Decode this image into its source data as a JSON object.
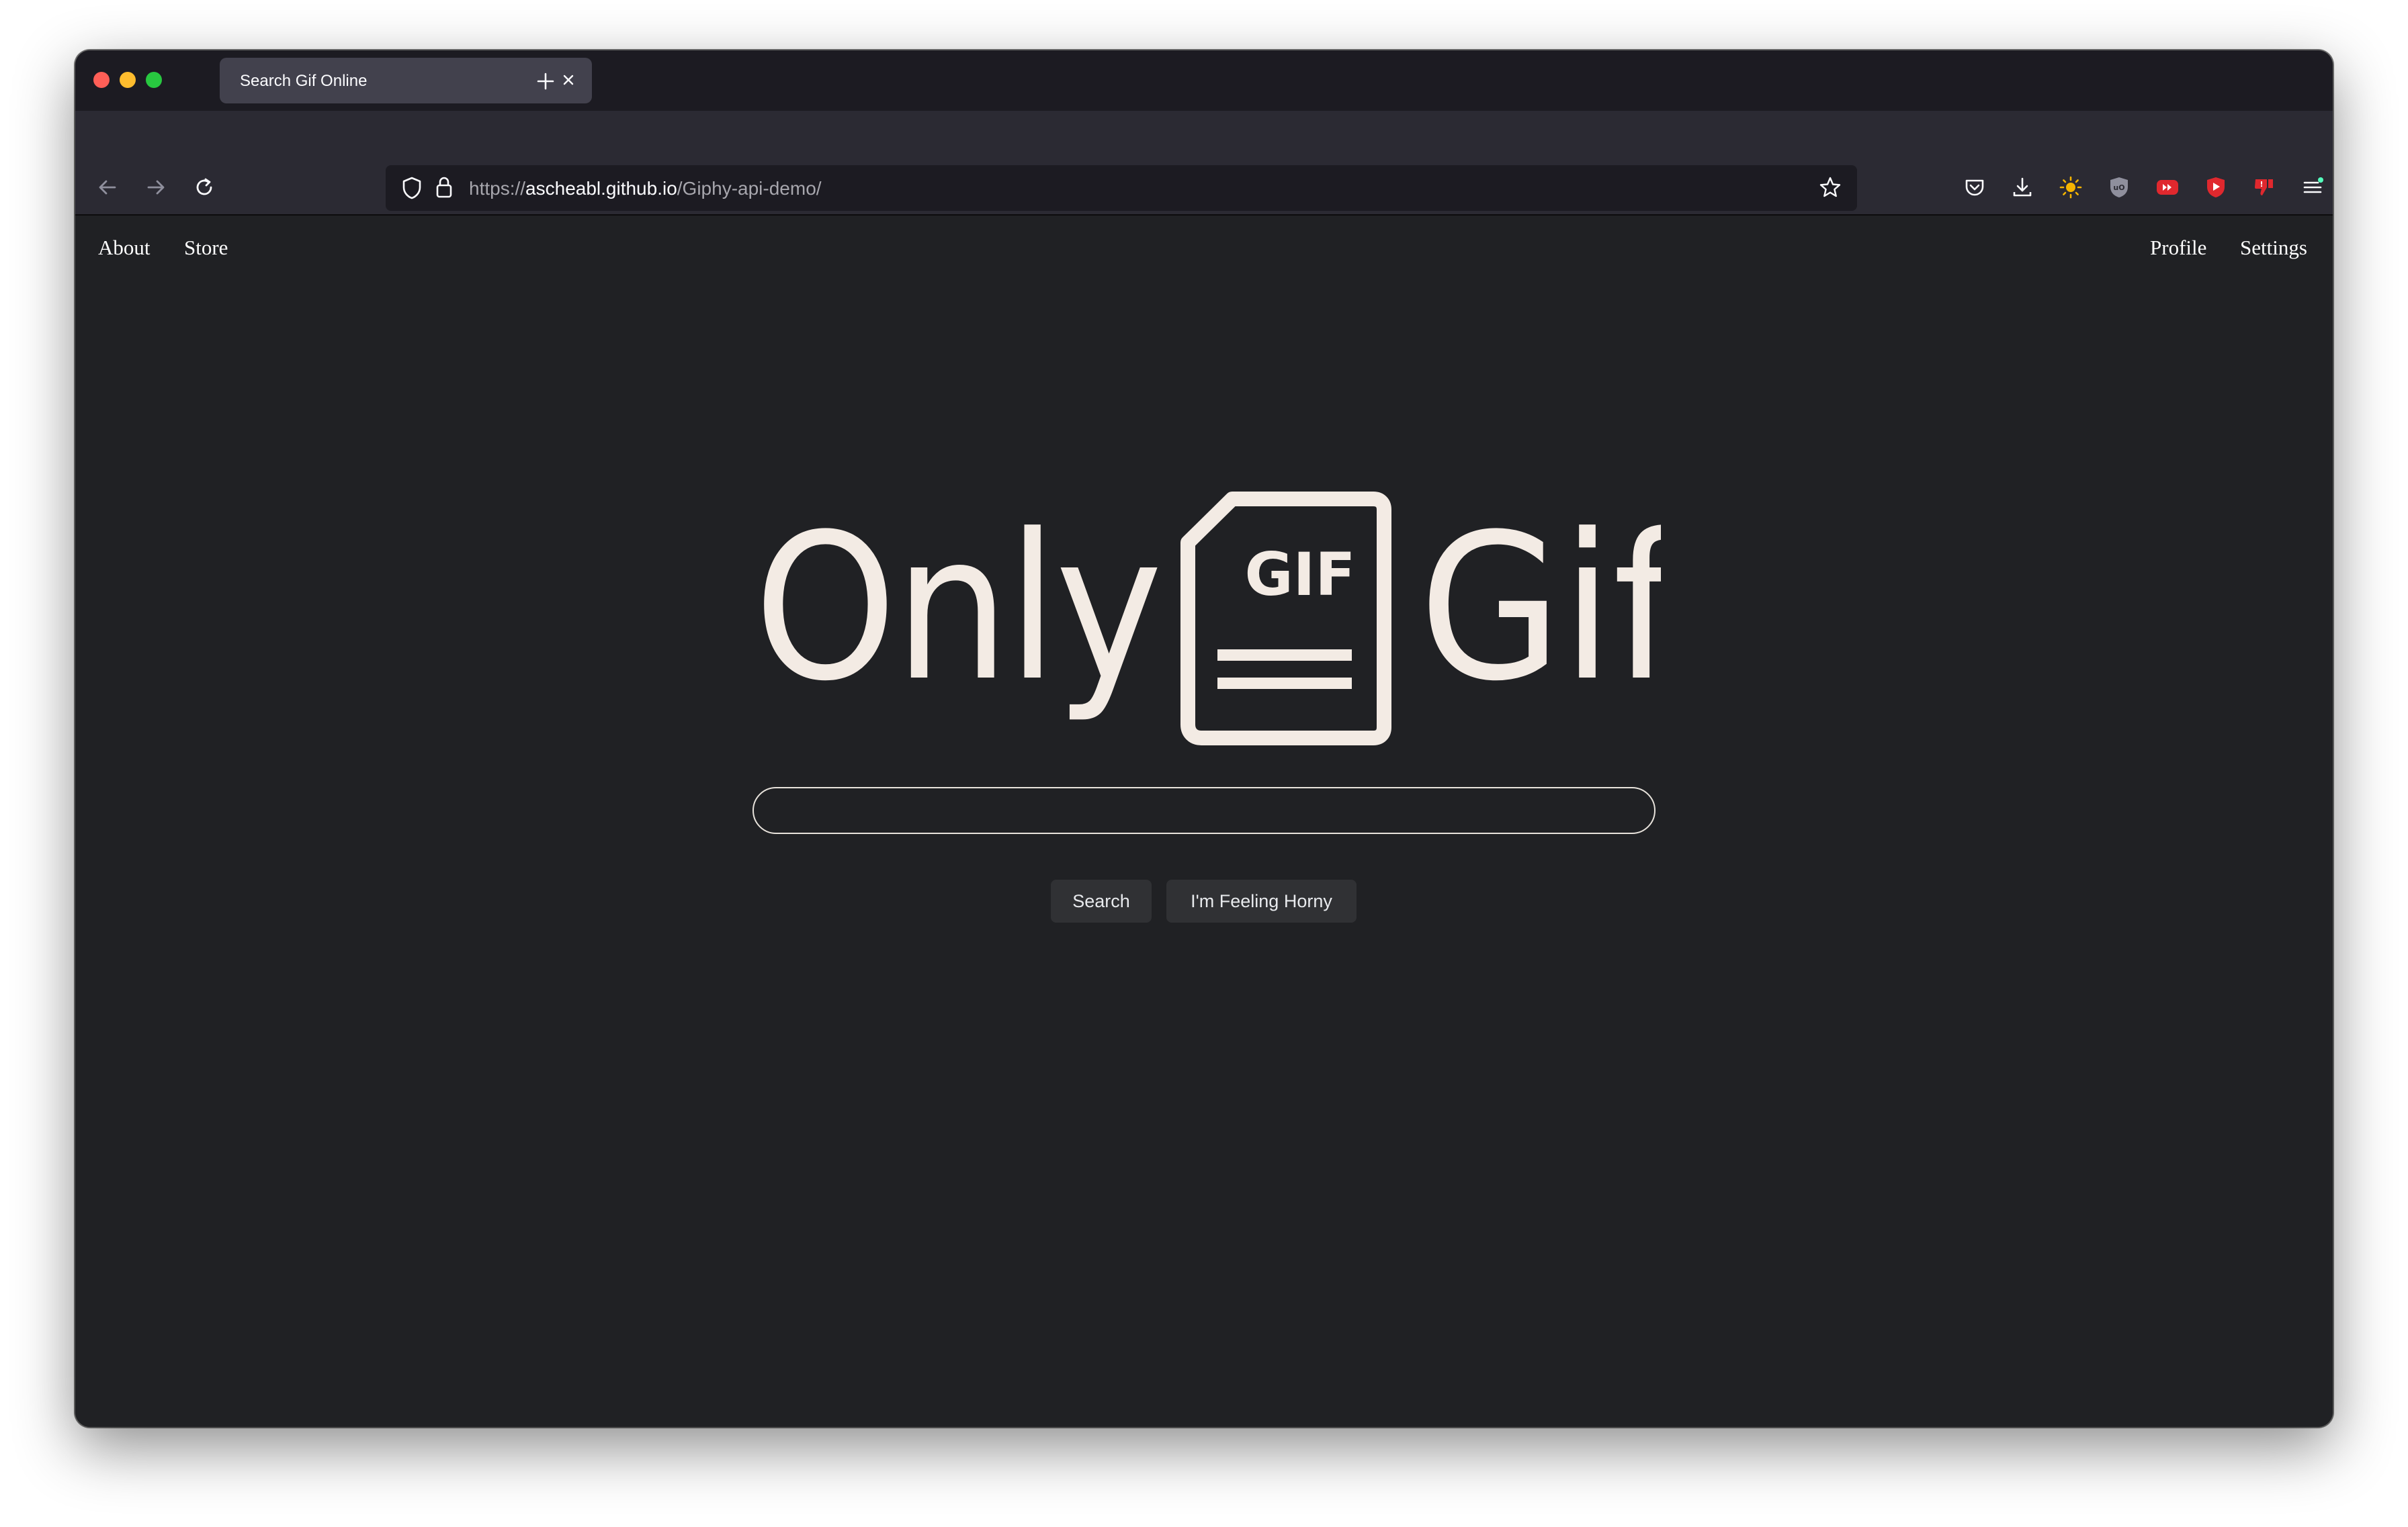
{
  "browser": {
    "tab": {
      "title": "Search Gif Online"
    },
    "urlbar": {
      "scheme": "https://",
      "host": "ascheabl.github.io",
      "path": "/Giphy-api-demo/"
    },
    "icons": {
      "window_controls": [
        "close-dot",
        "minimize-dot",
        "maximize-dot"
      ],
      "nav": [
        "back-arrow-icon",
        "forward-arrow-icon",
        "reload-icon"
      ],
      "url": [
        "shield-icon",
        "lock-icon",
        "star-icon"
      ],
      "extensions": [
        "pocket-icon",
        "download-icon",
        "sun-icon",
        "ublock-icon",
        "youtube-ff-icon",
        "youtube-icon",
        "dislike-icon",
        "menu-icon"
      ]
    },
    "colors": {
      "tabstrip": "#1c1b22",
      "toolbar": "#2b2a33",
      "urlbar": "#1c1b22"
    }
  },
  "page": {
    "nav_left": [
      {
        "label": "About"
      },
      {
        "label": "Store"
      }
    ],
    "nav_right": [
      {
        "label": "Profile"
      },
      {
        "label": "Settings"
      }
    ],
    "logo": {
      "left_word": "Only",
      "badge_text": "GIF",
      "right_word": "Gif",
      "color": "#f3ebe4"
    },
    "search": {
      "value": "",
      "placeholder": ""
    },
    "buttons": {
      "search_label": "Search",
      "lucky_label": "I'm Feeling Horny"
    },
    "colors": {
      "background": "#202124",
      "button_bg": "#303134",
      "button_text": "#e8eaed"
    }
  }
}
